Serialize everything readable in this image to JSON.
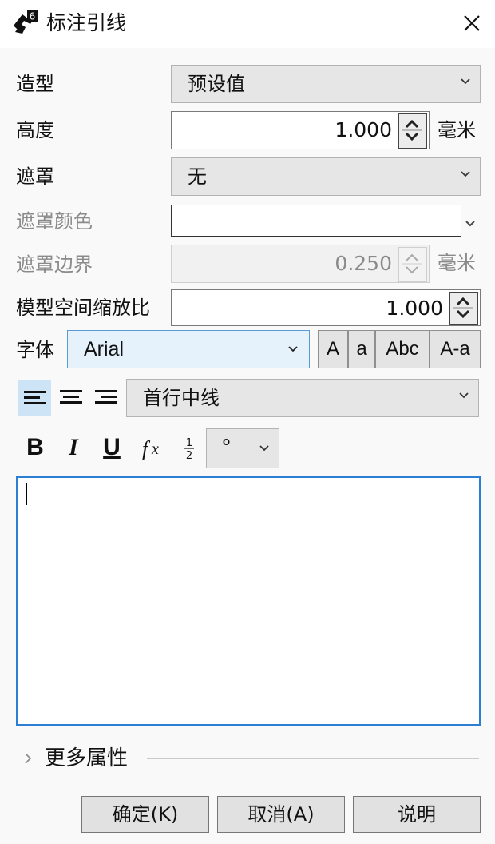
{
  "window": {
    "title": "标注引线"
  },
  "rows": {
    "style": {
      "label": "造型",
      "value": "预设值"
    },
    "height": {
      "label": "高度",
      "value": "1.000",
      "unit": "毫米"
    },
    "mask": {
      "label": "遮罩",
      "value": "无"
    },
    "mask_color": {
      "label": "遮罩颜色"
    },
    "mask_margin": {
      "label": "遮罩边界",
      "value": "0.250",
      "unit": "毫米"
    },
    "model_scale": {
      "label": "模型空间缩放比",
      "value": "1.000"
    },
    "font": {
      "label": "字体",
      "value": "Arial",
      "buttons": [
        "A",
        "a",
        "Abc",
        "A-a"
      ]
    },
    "justify": {
      "value": "首行中线"
    },
    "format": {
      "bold": "B",
      "italic": "I",
      "underline": "U",
      "symbol": "°"
    }
  },
  "more": {
    "label": "更多属性"
  },
  "buttons": {
    "ok": "确定(K)",
    "cancel": "取消(A)",
    "help": "说明"
  },
  "icons": [
    "app-icon",
    "close-icon",
    "chevron-down-icon",
    "spin-up-icon",
    "spin-down-icon",
    "align-left-icon",
    "align-center-icon",
    "align-right-icon",
    "function-icon",
    "fraction-icon",
    "chevron-right-icon"
  ],
  "colors": {
    "accent": "#2b7fd4",
    "selected_bg": "#cde4f7",
    "font_combo_bg": "#e5f1fb"
  }
}
